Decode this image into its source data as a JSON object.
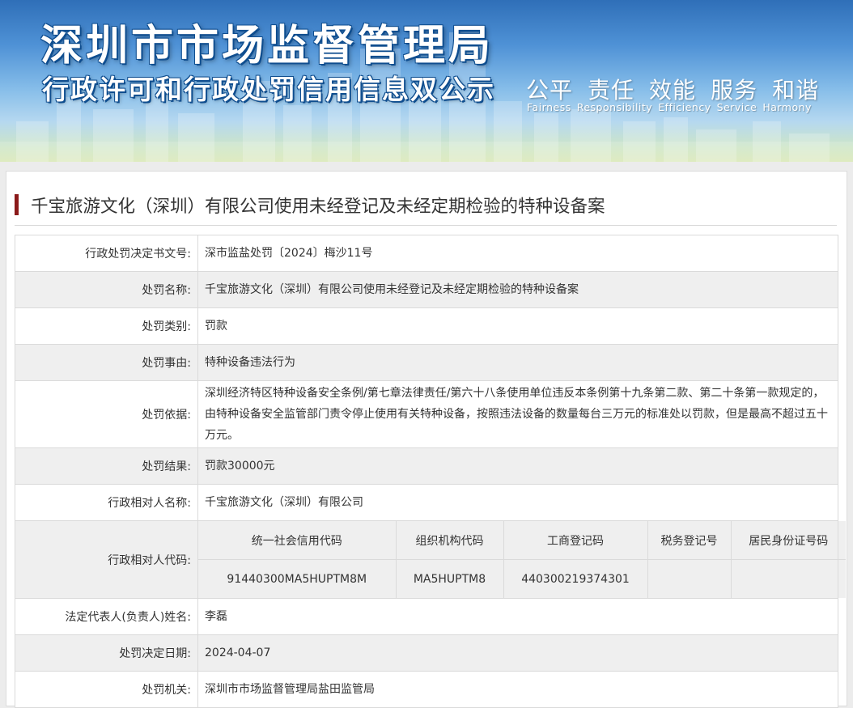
{
  "banner": {
    "title_main": "深圳市市场监督管理局",
    "title_sub": "行政许可和行政处罚信用信息双公示",
    "slogans_cn": [
      "公平",
      "责任",
      "效能",
      "服务",
      "和谐"
    ],
    "slogans_en": [
      "Fairness",
      "Responsibility",
      "Efficiency",
      "Service",
      "Harmony"
    ]
  },
  "case": {
    "title": "千宝旅游文化（深圳）有限公司使用未经登记及未经定期检验的特种设备案"
  },
  "fields": {
    "decision_no": {
      "label": "行政处罚决定书文号:",
      "value": "深市监盐处罚〔2024〕梅沙11号"
    },
    "penalty_name": {
      "label": "处罚名称:",
      "value": "千宝旅游文化（深圳）有限公司使用未经登记及未经定期检验的特种设备案"
    },
    "penalty_type": {
      "label": "处罚类别:",
      "value": "罚款"
    },
    "penalty_reason": {
      "label": "处罚事由:",
      "value": "特种设备违法行为"
    },
    "penalty_basis": {
      "label": "处罚依据:",
      "value": "深圳经济特区特种设备安全条例/第七章法律责任/第六十八条使用单位违反本条例第十九条第二款、第二十条第一款规定的，由特种设备安全监管部门责令停止使用有关特种设备，按照违法设备的数量每台三万元的标准处以罚款，但是最高不超过五十万元。"
    },
    "penalty_result": {
      "label": "处罚结果:",
      "value": "罚款30000元"
    },
    "party_name": {
      "label": "行政相对人名称:",
      "value": "千宝旅游文化（深圳）有限公司"
    },
    "party_code": {
      "label": "行政相对人代码:"
    },
    "legal_rep": {
      "label": "法定代表人(负责人)姓名:",
      "value": "李磊"
    },
    "decision_date": {
      "label": "处罚决定日期:",
      "value": "2024-04-07"
    },
    "authority": {
      "label": "处罚机关:",
      "value": "深圳市市场监督管理局盐田监管局"
    }
  },
  "codes": {
    "headers": [
      "统一社会信用代码",
      "组织机构代码",
      "工商登记码",
      "税务登记号",
      "居民身份证号码"
    ],
    "values": [
      "91440300MA5HUPTM8M",
      "MA5HUPTM8",
      "440300219374301",
      "",
      ""
    ]
  }
}
